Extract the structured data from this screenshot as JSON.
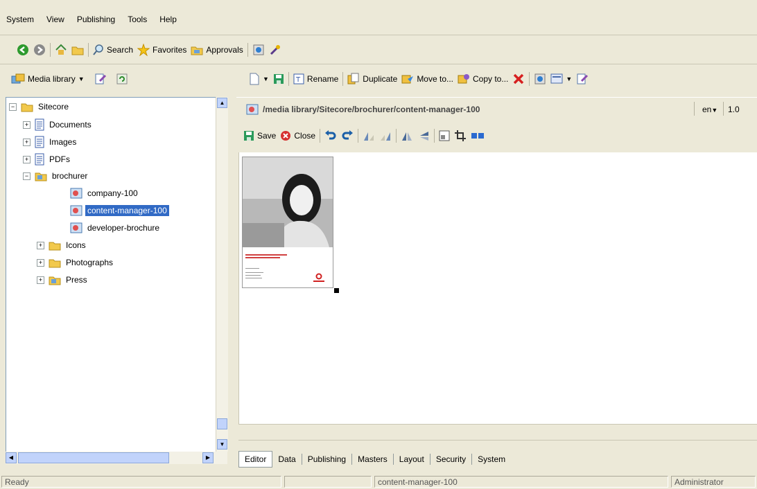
{
  "menu": [
    "System",
    "View",
    "Publishing",
    "Tools",
    "Help"
  ],
  "main_toolbar": {
    "search_label": "Search",
    "favorites_label": "Favorites",
    "approvals_label": "Approvals"
  },
  "left_toolbar": {
    "media_library_label": "Media library"
  },
  "right_toolbar": {
    "rename_label": "Rename",
    "duplicate_label": "Duplicate",
    "move_label": "Move to...",
    "copy_label": "Copy to..."
  },
  "tree": {
    "root": "Sitecore",
    "items": [
      {
        "label": "Documents"
      },
      {
        "label": "Images"
      },
      {
        "label": "PDFs"
      },
      {
        "label": "brochurer"
      },
      {
        "label": "company-100"
      },
      {
        "label": "content-manager-100"
      },
      {
        "label": "developer-brochure"
      },
      {
        "label": "Icons"
      },
      {
        "label": "Photographs"
      },
      {
        "label": "Press"
      }
    ]
  },
  "path": {
    "text": "/media library/Sitecore/brochurer/content-manager-100",
    "language": "en",
    "version": "1.0"
  },
  "editor_toolbar": {
    "save_label": "Save",
    "close_label": "Close"
  },
  "tabs": [
    "Editor",
    "Data",
    "Publishing",
    "Masters",
    "Layout",
    "Security",
    "System"
  ],
  "status": {
    "left": "Ready",
    "item": "content-manager-100",
    "user": "Administrator"
  },
  "colors": {
    "selection": "#316ac5",
    "chrome": "#ece9d8",
    "delete_red": "#d62020"
  }
}
